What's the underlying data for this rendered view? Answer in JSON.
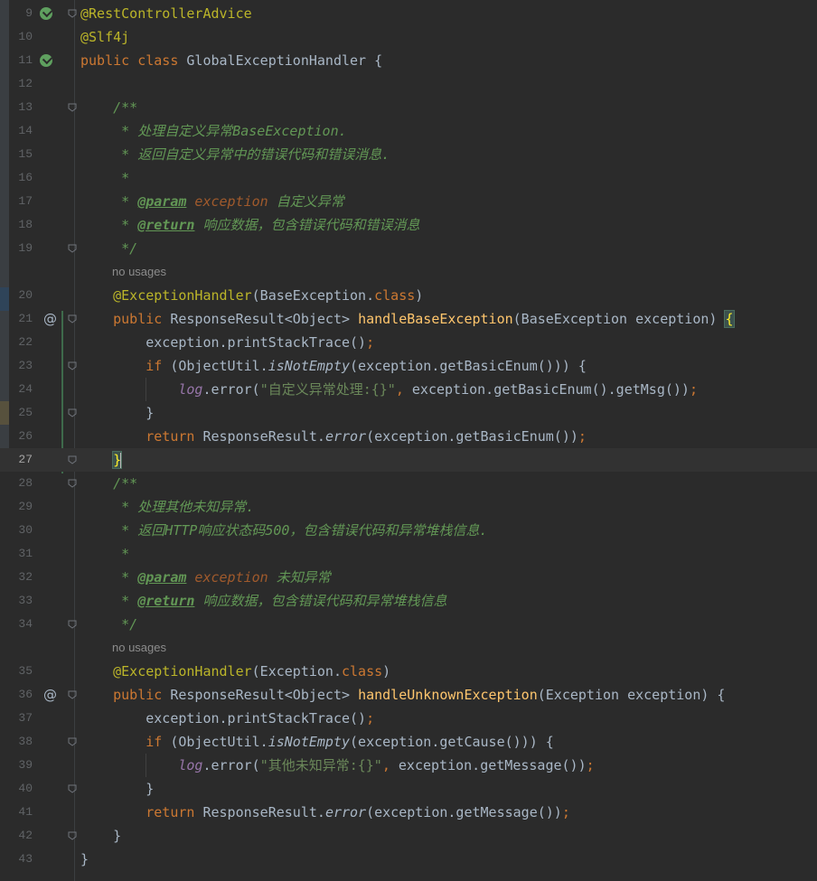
{
  "editor": {
    "lines": [
      {
        "n": "9",
        "tokens": [
          {
            "t": "@RestControllerAdvice",
            "c": "ann"
          }
        ]
      },
      {
        "n": "10",
        "tokens": [
          {
            "t": "@Slf4j",
            "c": "ann"
          }
        ]
      },
      {
        "n": "11",
        "tokens": [
          {
            "t": "public class ",
            "c": "kw"
          },
          {
            "t": "GlobalExceptionHandler {",
            "c": ""
          }
        ]
      },
      {
        "n": "12",
        "tokens": []
      },
      {
        "n": "13",
        "tokens": [
          {
            "t": "    /**",
            "c": "doc"
          }
        ]
      },
      {
        "n": "14",
        "tokens": [
          {
            "t": "     * 处理自定义异常BaseException.",
            "c": "doc"
          }
        ]
      },
      {
        "n": "15",
        "tokens": [
          {
            "t": "     * 返回自定义异常中的错误代码和错误消息.",
            "c": "doc"
          }
        ]
      },
      {
        "n": "16",
        "tokens": [
          {
            "t": "     *",
            "c": "doc"
          }
        ]
      },
      {
        "n": "17",
        "tokens": [
          {
            "t": "     * ",
            "c": "doc"
          },
          {
            "t": "@param",
            "c": "doctag"
          },
          {
            "t": " exception ",
            "c": "docparam"
          },
          {
            "t": "自定义异常",
            "c": "doc"
          }
        ]
      },
      {
        "n": "18",
        "tokens": [
          {
            "t": "     * ",
            "c": "doc"
          },
          {
            "t": "@return",
            "c": "doctag"
          },
          {
            "t": " 响应数据，包含错误代码和错误消息",
            "c": "doc"
          }
        ]
      },
      {
        "n": "19",
        "tokens": [
          {
            "t": "     */",
            "c": "doc"
          }
        ]
      },
      {
        "hint": "no usages"
      },
      {
        "n": "20",
        "tokens": [
          {
            "t": "    "
          },
          {
            "t": "@ExceptionHandler",
            "c": "ann"
          },
          {
            "t": "(BaseException."
          },
          {
            "t": "class",
            "c": "kw"
          },
          {
            "t": ")"
          }
        ]
      },
      {
        "n": "21",
        "tokens": [
          {
            "t": "    "
          },
          {
            "t": "public ",
            "c": "kw"
          },
          {
            "t": "ResponseResult<Object> "
          },
          {
            "t": "handleBaseException",
            "c": "fn"
          },
          {
            "t": "(BaseException exception) "
          },
          {
            "t": "{",
            "c": "brace-hl"
          }
        ]
      },
      {
        "n": "22",
        "tokens": [
          {
            "t": "        exception.printStackTrace()"
          },
          {
            "t": ";",
            "c": "kw"
          }
        ]
      },
      {
        "n": "23",
        "tokens": [
          {
            "t": "        "
          },
          {
            "t": "if ",
            "c": "kw"
          },
          {
            "t": "(ObjectUtil."
          },
          {
            "t": "isNotEmpty",
            "c": "static"
          },
          {
            "t": "(exception.getBasicEnum())) {"
          }
        ]
      },
      {
        "n": "24",
        "tokens": [
          {
            "t": "            "
          },
          {
            "t": "log",
            "c": "field"
          },
          {
            "t": ".error("
          },
          {
            "t": "\"自定义异常处理:{}\"",
            "c": "str"
          },
          {
            "t": ", ",
            "c": "kw"
          },
          {
            "t": "exception.getBasicEnum().getMsg())"
          },
          {
            "t": ";",
            "c": "kw"
          }
        ]
      },
      {
        "n": "25",
        "tokens": [
          {
            "t": "        }"
          }
        ]
      },
      {
        "n": "26",
        "tokens": [
          {
            "t": "        "
          },
          {
            "t": "return ",
            "c": "kw"
          },
          {
            "t": "ResponseResult."
          },
          {
            "t": "error",
            "c": "static"
          },
          {
            "t": "(exception.getBasicEnum())"
          },
          {
            "t": ";",
            "c": "kw"
          }
        ]
      },
      {
        "n": "27",
        "current": true,
        "tokens": [
          {
            "t": "    "
          },
          {
            "t": "}",
            "c": "brace-hl"
          },
          {
            "caret": true
          }
        ]
      },
      {
        "n": "28",
        "tokens": [
          {
            "t": "    /**",
            "c": "doc"
          }
        ]
      },
      {
        "n": "29",
        "tokens": [
          {
            "t": "     * 处理其他未知异常.",
            "c": "doc"
          }
        ]
      },
      {
        "n": "30",
        "tokens": [
          {
            "t": "     * 返回HTTP响应状态码500，包含错误代码和异常堆栈信息.",
            "c": "doc"
          }
        ]
      },
      {
        "n": "31",
        "tokens": [
          {
            "t": "     *",
            "c": "doc"
          }
        ]
      },
      {
        "n": "32",
        "tokens": [
          {
            "t": "     * ",
            "c": "doc"
          },
          {
            "t": "@param",
            "c": "doctag"
          },
          {
            "t": " exception ",
            "c": "docparam"
          },
          {
            "t": "未知异常",
            "c": "doc"
          }
        ]
      },
      {
        "n": "33",
        "tokens": [
          {
            "t": "     * ",
            "c": "doc"
          },
          {
            "t": "@return",
            "c": "doctag"
          },
          {
            "t": " 响应数据，包含错误代码和异常堆栈信息",
            "c": "doc"
          }
        ]
      },
      {
        "n": "34",
        "tokens": [
          {
            "t": "     */",
            "c": "doc"
          }
        ]
      },
      {
        "hint": "no usages"
      },
      {
        "n": "35",
        "tokens": [
          {
            "t": "    "
          },
          {
            "t": "@ExceptionHandler",
            "c": "ann"
          },
          {
            "t": "(Exception."
          },
          {
            "t": "class",
            "c": "kw"
          },
          {
            "t": ")"
          }
        ]
      },
      {
        "n": "36",
        "tokens": [
          {
            "t": "    "
          },
          {
            "t": "public ",
            "c": "kw"
          },
          {
            "t": "ResponseResult<Object> "
          },
          {
            "t": "handleUnknownException",
            "c": "fn"
          },
          {
            "t": "(Exception exception) {"
          }
        ]
      },
      {
        "n": "37",
        "tokens": [
          {
            "t": "        exception.printStackTrace()"
          },
          {
            "t": ";",
            "c": "kw"
          }
        ]
      },
      {
        "n": "38",
        "tokens": [
          {
            "t": "        "
          },
          {
            "t": "if ",
            "c": "kw"
          },
          {
            "t": "(ObjectUtil."
          },
          {
            "t": "isNotEmpty",
            "c": "static"
          },
          {
            "t": "(exception.getCause())) {"
          }
        ]
      },
      {
        "n": "39",
        "tokens": [
          {
            "t": "            "
          },
          {
            "t": "log",
            "c": "field"
          },
          {
            "t": ".error("
          },
          {
            "t": "\"其他未知异常:{}\"",
            "c": "str"
          },
          {
            "t": ", ",
            "c": "kw"
          },
          {
            "t": "exception.getMessage())"
          },
          {
            "t": ";",
            "c": "kw"
          }
        ]
      },
      {
        "n": "40",
        "tokens": [
          {
            "t": "        }"
          }
        ]
      },
      {
        "n": "41",
        "tokens": [
          {
            "t": "        "
          },
          {
            "t": "return ",
            "c": "kw"
          },
          {
            "t": "ResponseResult."
          },
          {
            "t": "error",
            "c": "static"
          },
          {
            "t": "(exception.getMessage())"
          },
          {
            "t": ";",
            "c": "kw"
          }
        ]
      },
      {
        "n": "42",
        "tokens": [
          {
            "t": "    }"
          }
        ]
      },
      {
        "n": "43",
        "tokens": [
          {
            "t": "}"
          }
        ]
      }
    ],
    "gutter_icons": {
      "9": "bean-icon",
      "11": "bean-icon",
      "21": "at-icon",
      "36": "at-icon"
    },
    "at_symbol": "@",
    "fold_lines": [
      "9",
      "13",
      "19",
      "21",
      "23",
      "25",
      "27",
      "28",
      "34",
      "36",
      "38",
      "40",
      "42"
    ]
  }
}
